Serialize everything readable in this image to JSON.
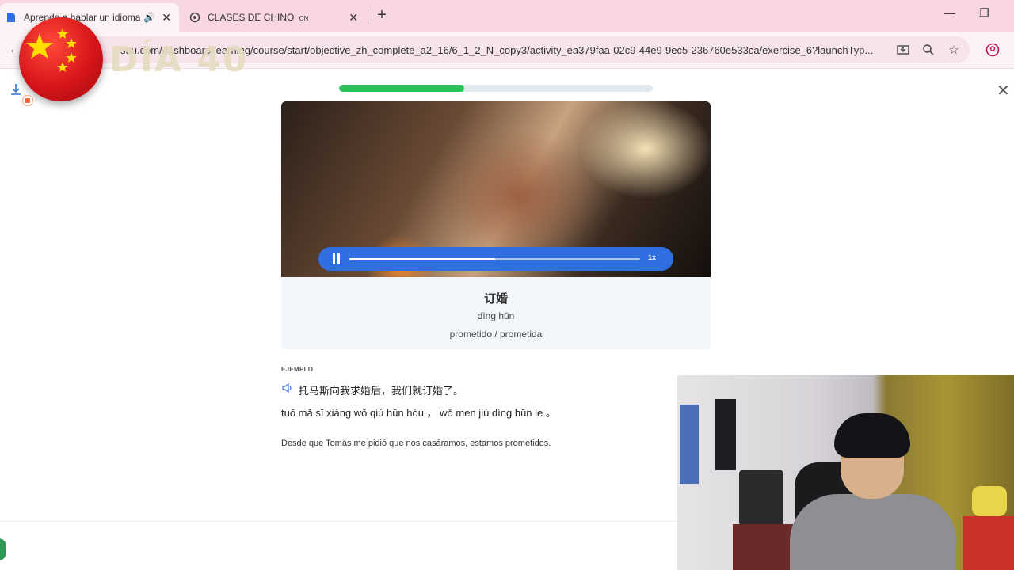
{
  "browser": {
    "tabs": [
      {
        "title": "Aprende a hablar un idioma",
        "active": true
      },
      {
        "title": "CLASES DE CHINO",
        "badge": "CN",
        "active": false
      }
    ],
    "url": "busuu.com/dashboard/learning/course/start/objective_zh_complete_a2_16/6_1_2_N_copy3/activity_ea379faa-02c9-44e9-9ec5-236760e533ca/exercise_6?launchTyp...",
    "url_visible": "suu.com/dashboard/learning/course/start/objective_zh_complete_a2_16/6_1_2_N_copy3/activity_ea379faa-02c9-44e9-9ec5-236760e533ca/exercise_6?launchTyp..."
  },
  "overlay": {
    "day_label": "DÍA 40"
  },
  "lesson": {
    "progress_fraction": 0.4,
    "player": {
      "speed": "1x",
      "played_fraction": 0.5
    },
    "word": {
      "hanzi": "订婚",
      "pinyin": "dìng hūn",
      "meaning": "prometido / prometida"
    },
    "example": {
      "label": "EJEMPLO",
      "chinese": "托马斯向我求婚后，我们就订婚了。",
      "pinyin": "tuō mǎ sī xiàng wǒ qiú hūn hòu ， wǒ men jiù dìng hūn le 。",
      "translation": "Desde que Tomás me pidió que nos casáramos, estamos prometidos."
    }
  },
  "colors": {
    "accent_blue": "#2f6fe0",
    "progress_green": "#27c25b",
    "tabbar_pink": "#f8d7e0"
  }
}
